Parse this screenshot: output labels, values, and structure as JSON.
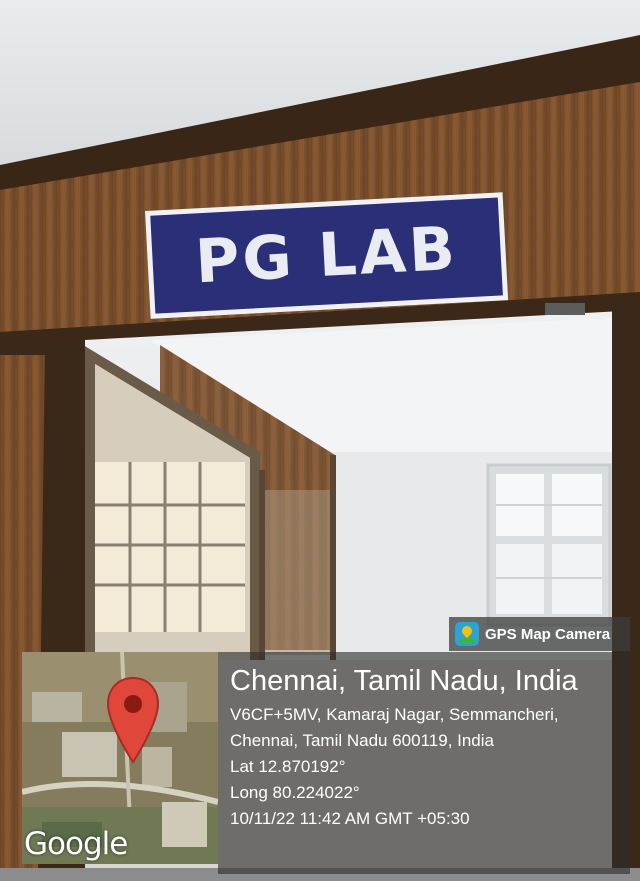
{
  "sign": {
    "text": "PG LAB"
  },
  "gps_badge": {
    "icon": "gps-map-camera-icon",
    "label": "GPS Map Camera"
  },
  "map": {
    "logo": "Google",
    "pin_icon": "location-pin-icon",
    "pin_color": "#e0463a"
  },
  "location": {
    "title": "Chennai, Tamil Nadu, India",
    "address_line1": "V6CF+5MV, Kamaraj Nagar, Semmancheri,",
    "address_line2": "Chennai, Tamil Nadu 600119, India",
    "lat": "Lat 12.870192°",
    "long": "Long 80.224022°",
    "timestamp": "10/11/22 11:42 AM GMT +05:30"
  }
}
